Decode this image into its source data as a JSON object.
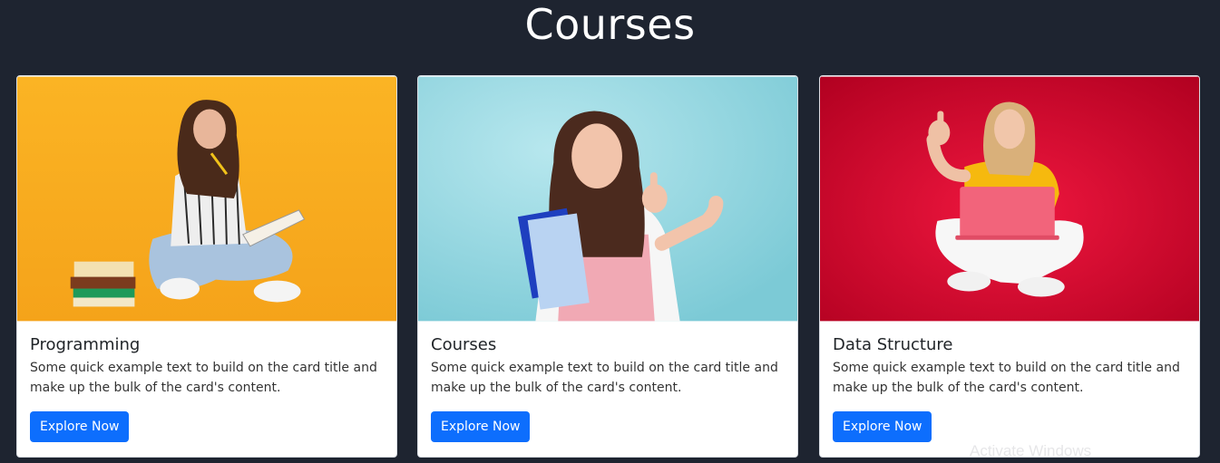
{
  "page": {
    "title": "Courses"
  },
  "cards": [
    {
      "title": "Programming",
      "text": "Some quick example text to build on the card title and make up the bulk of the card's content.",
      "button": "Explore Now",
      "image": "woman-with-notebook-photo"
    },
    {
      "title": "Courses",
      "text": "Some quick example text to build on the card title and make up the bulk of the card's content.",
      "button": "Explore Now",
      "image": "student-thumbs-up-photo"
    },
    {
      "title": "Data Structure",
      "text": "Some quick example text to build on the card title and make up the bulk of the card's content.",
      "button": "Explore Now",
      "image": "woman-with-laptop-photo"
    }
  ],
  "watermark": "Activate Windows",
  "colors": {
    "background": "#1e2430",
    "button": "#0d6efd",
    "card1_bg": "#f8b51d",
    "card2_bg": "#8fd5df",
    "card3_bg": "#d6002b"
  }
}
